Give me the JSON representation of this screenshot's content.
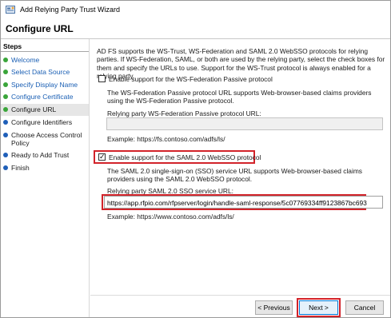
{
  "window": {
    "title": "Add Relying Party Trust Wizard",
    "page_title": "Configure URL"
  },
  "steps": {
    "title": "Steps",
    "items": [
      {
        "label": "Welcome",
        "state": "done"
      },
      {
        "label": "Select Data Source",
        "state": "done"
      },
      {
        "label": "Specify Display Name",
        "state": "done"
      },
      {
        "label": "Configure Certificate",
        "state": "done"
      },
      {
        "label": "Configure URL",
        "state": "current"
      },
      {
        "label": "Configure Identifiers",
        "state": "todo"
      },
      {
        "label": "Choose Access Control Policy",
        "state": "todo"
      },
      {
        "label": "Ready to Add Trust",
        "state": "todo"
      },
      {
        "label": "Finish",
        "state": "todo"
      }
    ]
  },
  "content": {
    "intro": "AD FS supports the WS-Trust, WS-Federation and SAML 2.0 WebSSO protocols for relying parties.  If WS-Federation, SAML, or both are used by the relying party, select the check boxes for them and specify the URLs to use.  Support for the WS-Trust protocol is always enabled for a relying party.",
    "wsfed": {
      "checkbox_label": "Enable support for the WS-Federation Passive protocol",
      "checked": false,
      "description": "The WS-Federation Passive protocol URL supports Web-browser-based claims providers using the WS-Federation Passive protocol.",
      "field_label": "Relying party WS-Federation Passive protocol URL:",
      "value": "",
      "example": "Example: https://fs.contoso.com/adfs/ls/"
    },
    "saml": {
      "checkbox_label": "Enable support for the SAML 2.0 WebSSO protocol",
      "checked": true,
      "check_glyph": "✓",
      "description": "The SAML 2.0 single-sign-on (SSO) service URL supports Web-browser-based claims providers using the SAML 2.0 WebSSO protocol.",
      "field_label": "Relying party SAML 2.0 SSO service URL:",
      "value": "https://app.rfpio.com/rfpserver/login/handle-saml-response/5c07769334ff9123867bc693",
      "example": "Example: https://www.contoso.com/adfs/ls/"
    }
  },
  "buttons": {
    "previous": "< Previous",
    "next": "Next >",
    "cancel": "Cancel"
  },
  "colors": {
    "highlight_box": "#d2232a",
    "step_done": "#3aa53a",
    "step_todo": "#1f5fb8",
    "link_text": "#1a5fb4"
  }
}
